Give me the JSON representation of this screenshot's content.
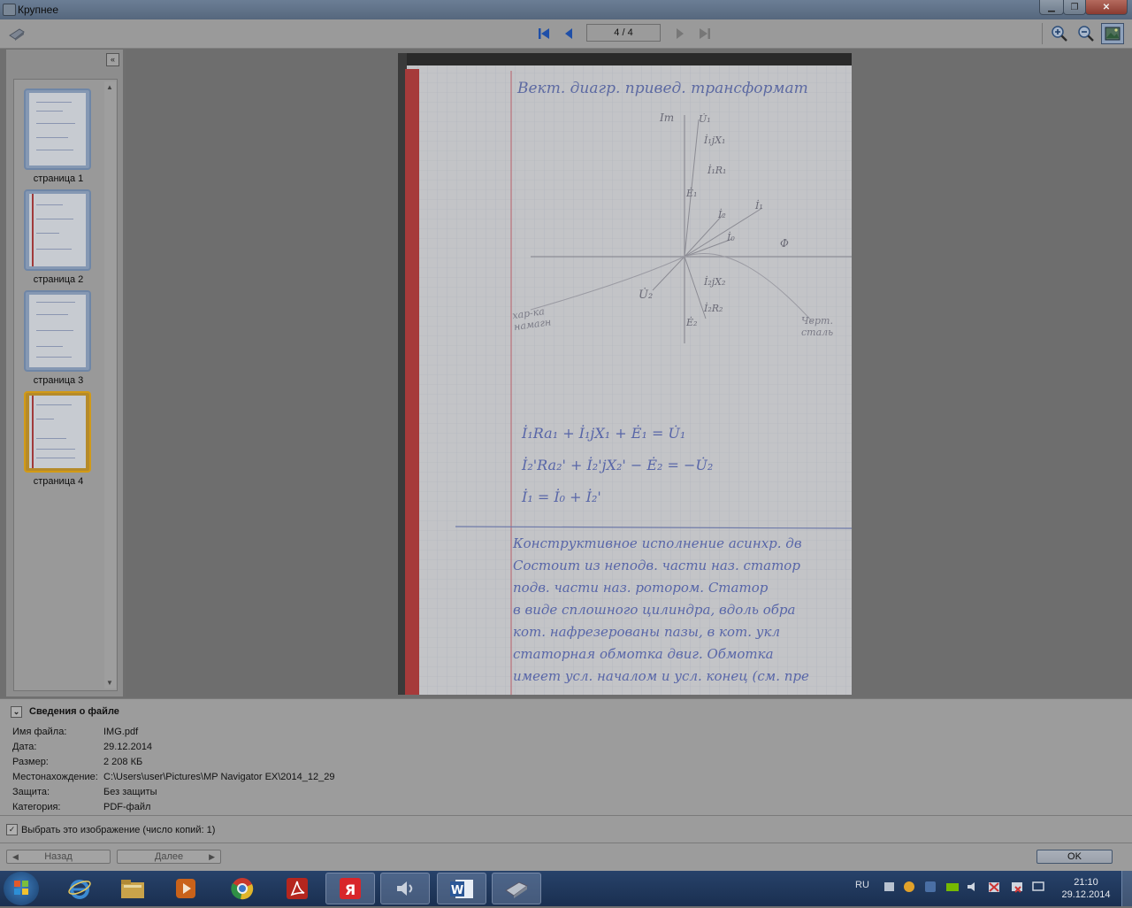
{
  "window": {
    "title": "Крупнее"
  },
  "toolbar": {
    "page_indicator": "4 / 4",
    "first_label": "first-page",
    "prev_label": "previous-page",
    "next_label": "next-page",
    "last_label": "last-page",
    "icons": [
      "scanner-icon",
      "zoom-in-icon",
      "zoom-out-icon",
      "fit-image-icon"
    ]
  },
  "thumbnails": [
    {
      "label": "страница 1"
    },
    {
      "label": "страница 2"
    },
    {
      "label": "страница 3"
    },
    {
      "label": "страница 4",
      "selected": true
    }
  ],
  "document": {
    "handwriting": {
      "heading": "Вект. диагр. привед. трансформат",
      "axis_labels": [
        "Im",
        "Φ"
      ],
      "vector_labels": [
        "U̇₁",
        "İ₁jX₁",
        "İ₁R₁",
        "Ė₁",
        "İ₁",
        "İ₂",
        "İ₀",
        "U̇₂",
        "İ₂jX₂",
        "İ₂R₂",
        "Ė₂"
      ],
      "side_left": "хар-ка намагн",
      "side_right": "Черт. сталь",
      "eq1": "İ₁Ra₁ + İ₁jX₁ + Ė₁ = U̇₁",
      "eq2": "İ₂'Ra₂' + İ₂'jX₂' − Ė₂ = −U̇₂",
      "eq3": "İ₁ = İ₀ + İ₂'",
      "para": [
        "Конструктивное исполнение асинхр. дв",
        "Состоит из неподв. части наз. статор",
        "подв. части наз. ротором. Статор",
        "в виде сплошного цилиндра, вдоль обра",
        "кот. нафрезерованы пазы, в кот. укл",
        "статорная обмотка двиг. Обмотка",
        "имеет усл. началом и усл. конец (см. пре"
      ]
    }
  },
  "file_info": {
    "header": "Сведения о файле",
    "rows": [
      {
        "key": "Имя файла:",
        "value": "IMG.pdf"
      },
      {
        "key": "Дата:",
        "value": "29.12.2014"
      },
      {
        "key": "Размер:",
        "value": "2 208 КБ"
      },
      {
        "key": "Местонахождение:",
        "value": "C:\\Users\\user\\Pictures\\MP Navigator EX\\2014_12_29"
      },
      {
        "key": "Защита:",
        "value": "Без защиты"
      },
      {
        "key": "Категория:",
        "value": "PDF-файл"
      }
    ]
  },
  "select_image": {
    "label": "Выбрать это изображение (число копий: 1)",
    "checked": true
  },
  "bottom_nav": {
    "back": "Назад",
    "next": "Далее",
    "ok": "OK"
  },
  "taskbar": {
    "apps": [
      "internet-explorer-icon",
      "file-explorer-icon",
      "media-player-icon",
      "chrome-icon",
      "acrobat-icon",
      "yandex-icon",
      "volume-app-icon",
      "word-icon",
      "scanner-app-icon"
    ],
    "lang": "RU",
    "time": "21:10",
    "date": "29.12.2014"
  }
}
